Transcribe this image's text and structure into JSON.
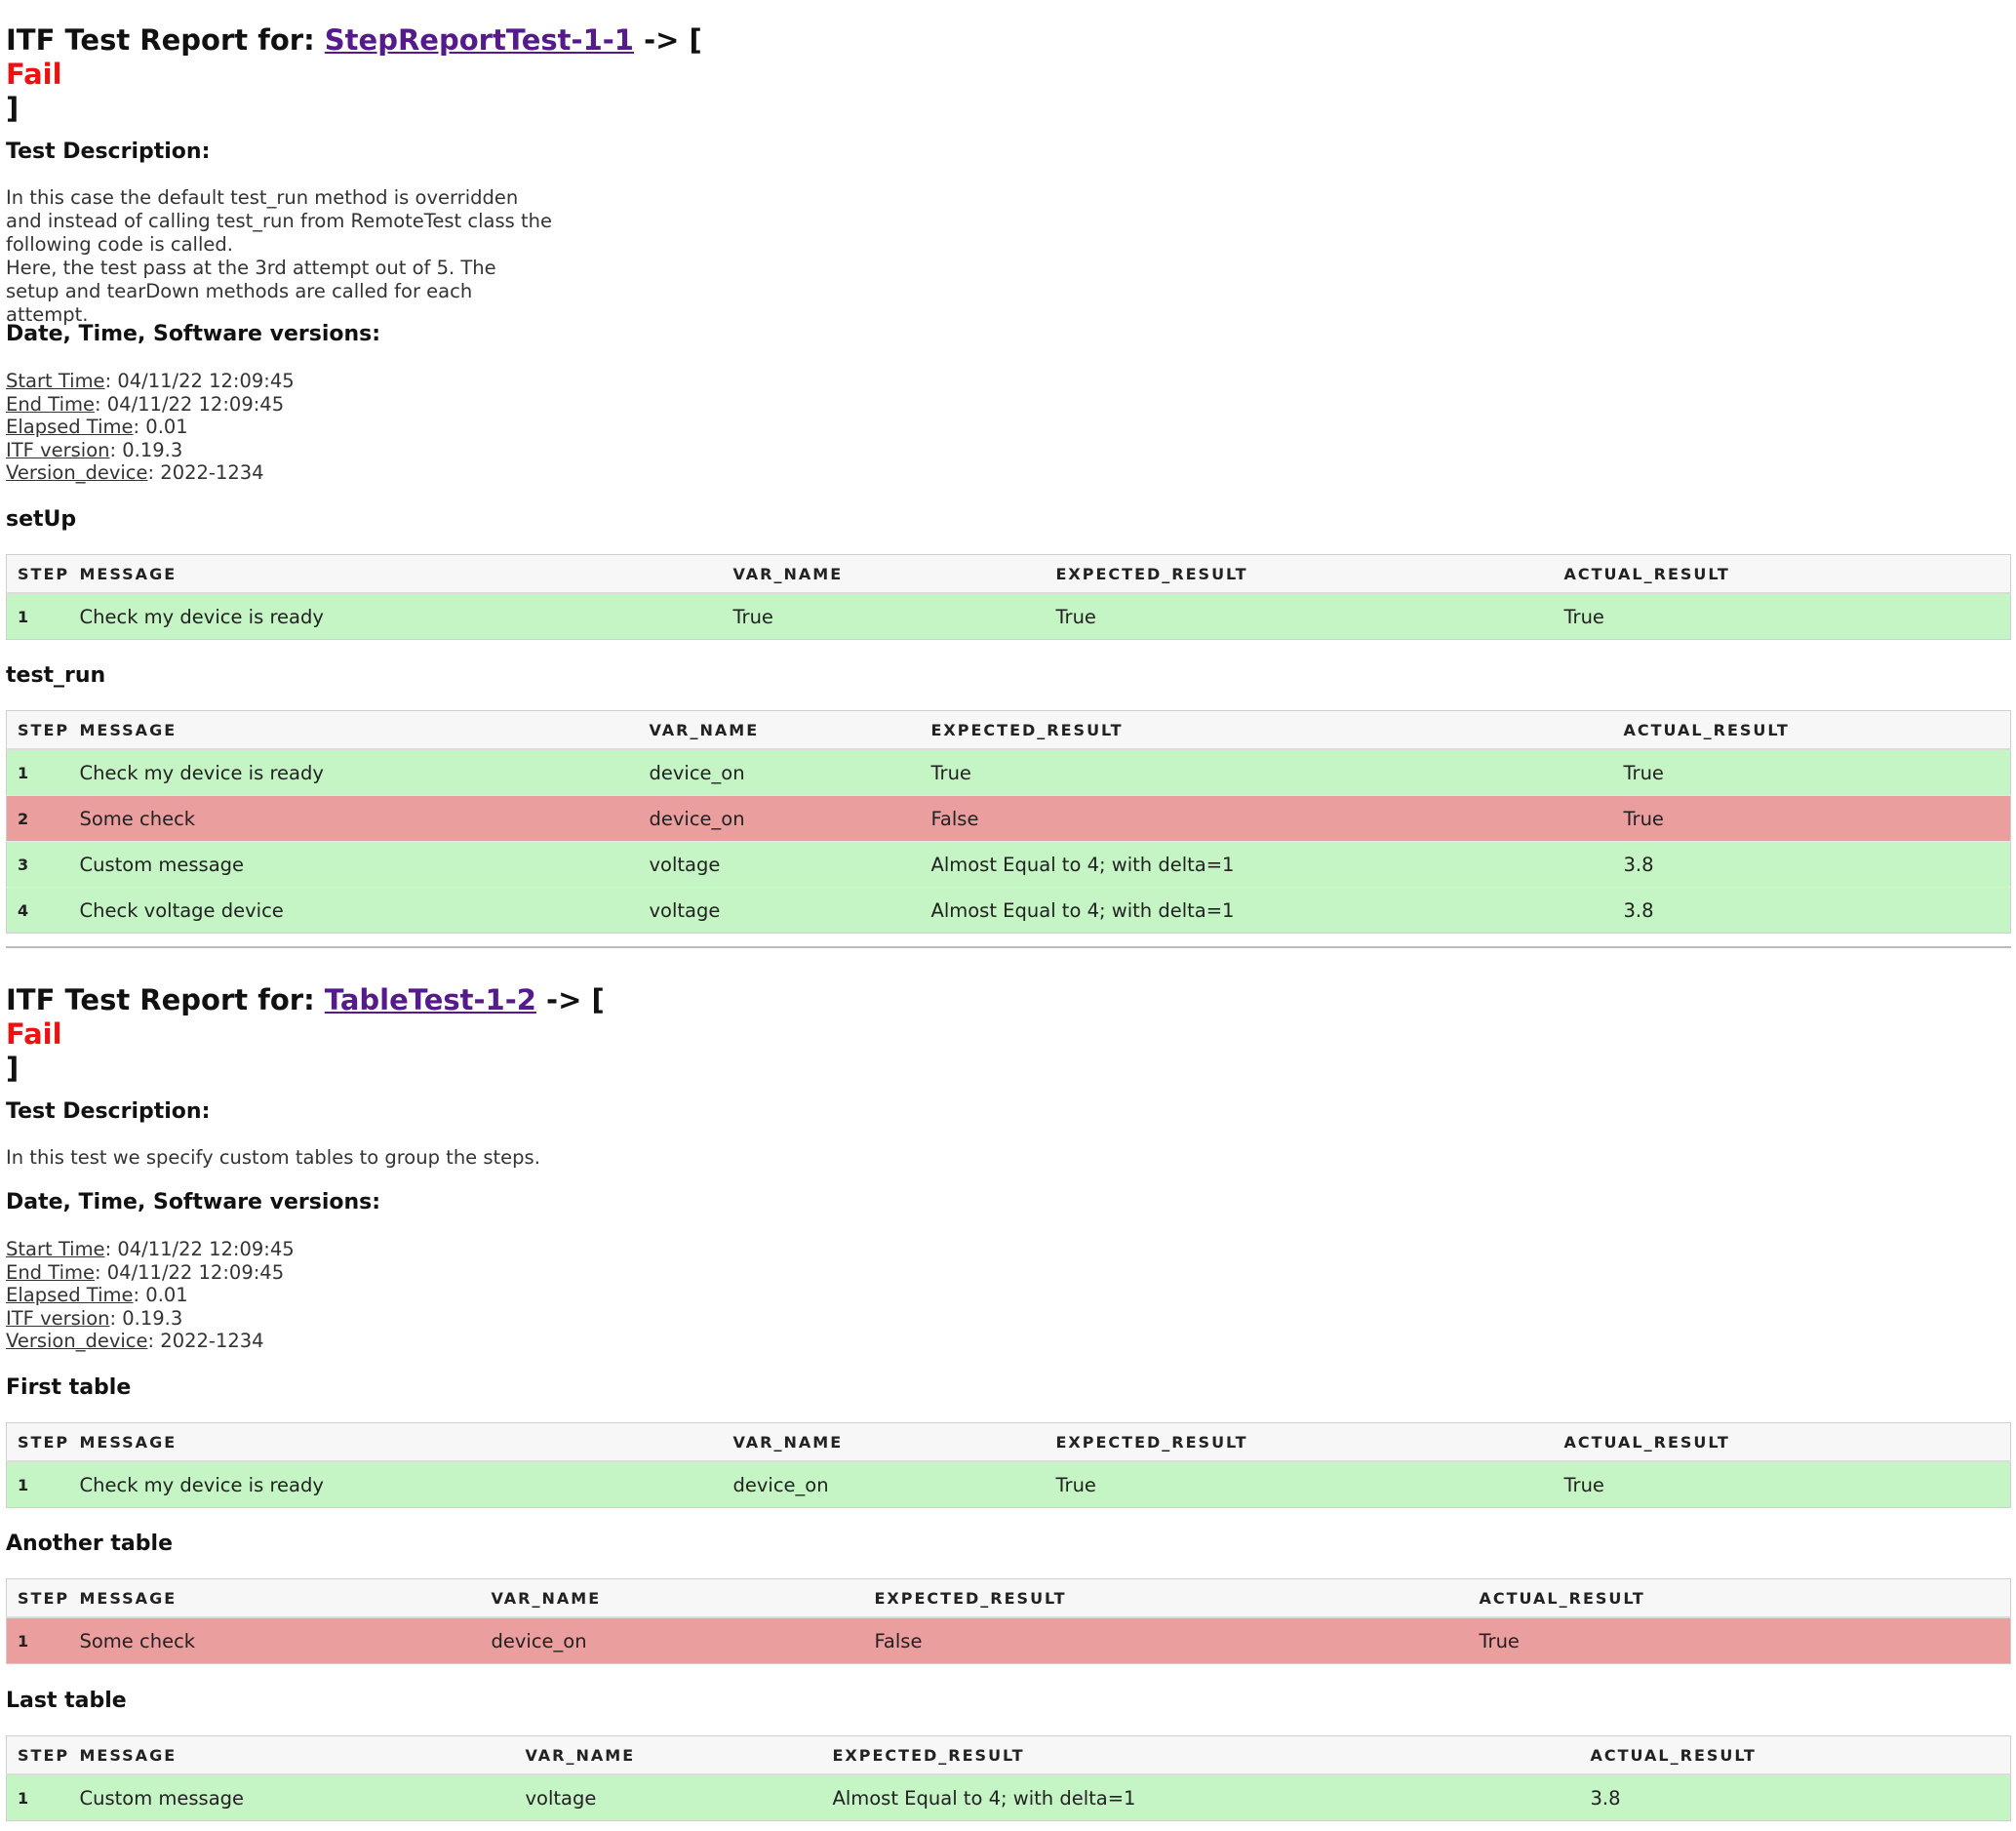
{
  "reports": [
    {
      "title_prefix": "ITF Test Report for:",
      "test_name": "StepReportTest-1-1",
      "arrow": "-> [",
      "result": "Fail",
      "close": "]",
      "desc_heading": "Test Description:",
      "description": "In this case the default test_run method is overridden and instead of calling test_run from RemoteTest class the following code is called.\nHere, the test pass at the 3rd attempt out of 5. The setup and tearDown methods are called for each attempt.",
      "versions_heading": "Date, Time, Software versions:",
      "meta": [
        {
          "key": "Start Time",
          "value": ": 04/11/22 12:09:45"
        },
        {
          "key": "End Time",
          "value": ": 04/11/22 12:09:45"
        },
        {
          "key": "Elapsed Time",
          "value": ": 0.01"
        },
        {
          "key": "ITF version",
          "value": ": 0.19.3"
        },
        {
          "key": "Version_device",
          "value": ": 2022-1234"
        }
      ],
      "tables": [
        {
          "name": "setUp",
          "columns": [
            "STEP",
            "MESSAGE",
            "VAR_NAME",
            "EXPECTED_RESULT",
            "ACTUAL_RESULT"
          ],
          "rows": [
            {
              "status": "pass",
              "cells": [
                "1",
                "Check my device is ready",
                "True",
                "True",
                "True"
              ]
            }
          ]
        },
        {
          "name": "test_run",
          "columns": [
            "STEP",
            "MESSAGE",
            "VAR_NAME",
            "EXPECTED_RESULT",
            "ACTUAL_RESULT"
          ],
          "rows": [
            {
              "status": "pass",
              "cells": [
                "1",
                "Check my device is ready",
                "device_on",
                "True",
                "True"
              ]
            },
            {
              "status": "fail",
              "cells": [
                "2",
                "Some check",
                "device_on",
                "False",
                "True"
              ]
            },
            {
              "status": "pass",
              "cells": [
                "3",
                "Custom message",
                "voltage",
                "Almost Equal to 4; with delta=1",
                "3.8"
              ]
            },
            {
              "status": "pass",
              "cells": [
                "4",
                "Check voltage device",
                "voltage",
                "Almost Equal to 4; with delta=1",
                "3.8"
              ]
            }
          ]
        }
      ]
    },
    {
      "title_prefix": "ITF Test Report for:",
      "test_name": "TableTest-1-2",
      "arrow": "-> [",
      "result": "Fail",
      "close": "]",
      "desc_heading": "Test Description:",
      "description": "In this test we specify custom tables to group the steps.",
      "versions_heading": "Date, Time, Software versions:",
      "meta": [
        {
          "key": "Start Time",
          "value": ": 04/11/22 12:09:45"
        },
        {
          "key": "End Time",
          "value": ": 04/11/22 12:09:45"
        },
        {
          "key": "Elapsed Time",
          "value": ": 0.01"
        },
        {
          "key": "ITF version",
          "value": ": 0.19.3"
        },
        {
          "key": "Version_device",
          "value": ": 2022-1234"
        }
      ],
      "tables": [
        {
          "name": "First table",
          "columns": [
            "STEP",
            "MESSAGE",
            "VAR_NAME",
            "EXPECTED_RESULT",
            "ACTUAL_RESULT"
          ],
          "rows": [
            {
              "status": "pass",
              "cells": [
                "1",
                "Check my device is ready",
                "device_on",
                "True",
                "True"
              ]
            }
          ]
        },
        {
          "name": "Another table",
          "columns": [
            "STEP",
            "MESSAGE",
            "VAR_NAME",
            "EXPECTED_RESULT",
            "ACTUAL_RESULT"
          ],
          "rows": [
            {
              "status": "fail",
              "cells": [
                "1",
                "Some check",
                "device_on",
                "False",
                "True"
              ]
            }
          ]
        },
        {
          "name": "Last table",
          "columns": [
            "STEP",
            "MESSAGE",
            "VAR_NAME",
            "EXPECTED_RESULT",
            "ACTUAL_RESULT"
          ],
          "rows": [
            {
              "status": "pass",
              "cells": [
                "1",
                "Custom message",
                "voltage",
                "Almost Equal to 4; with delta=1",
                "3.8"
              ]
            }
          ]
        }
      ]
    }
  ]
}
